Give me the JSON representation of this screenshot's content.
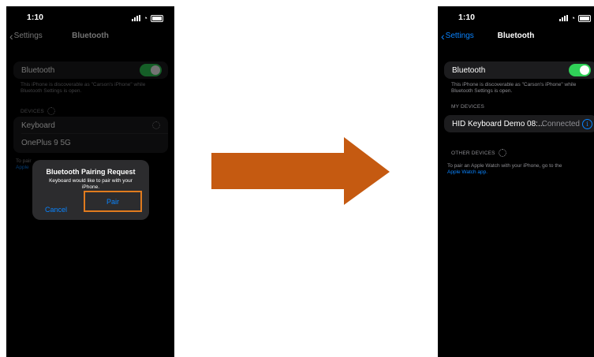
{
  "left": {
    "status_time": "1:10",
    "back_label": "Settings",
    "nav_title": "Bluetooth",
    "bt_label": "Bluetooth",
    "discoverable_note": "This iPhone is discoverable as \"Carson's iPhone\" while Bluetooth Settings is open.",
    "devices_header": "DEVICES",
    "devices": [
      "Keyboard",
      "OnePlus 9 5G"
    ],
    "footer_partial_1": "To pair",
    "footer_partial_2": "Apple",
    "dialog": {
      "title": "Bluetooth Pairing Request",
      "message": "Keyboard would like to pair with your iPhone.",
      "cancel": "Cancel",
      "pair": "Pair"
    }
  },
  "right": {
    "status_time": "1:10",
    "back_label": "Settings",
    "nav_title": "Bluetooth",
    "bt_label": "Bluetooth",
    "discoverable_note": "This iPhone is discoverable as \"Carson's iPhone\" while Bluetooth Settings is open.",
    "my_devices_header": "MY DEVICES",
    "device_name": "HID Keyboard Demo 08:...",
    "device_status": "Connected",
    "other_devices_header": "OTHER DEVICES",
    "watch_note": "To pair an Apple Watch with your iPhone, go to the",
    "watch_link": "Apple Watch app."
  },
  "colors": {
    "toggle_on": "#30d158",
    "link": "#0a84ff",
    "highlight": "#e07b1e",
    "arrow": "#c55a11"
  }
}
